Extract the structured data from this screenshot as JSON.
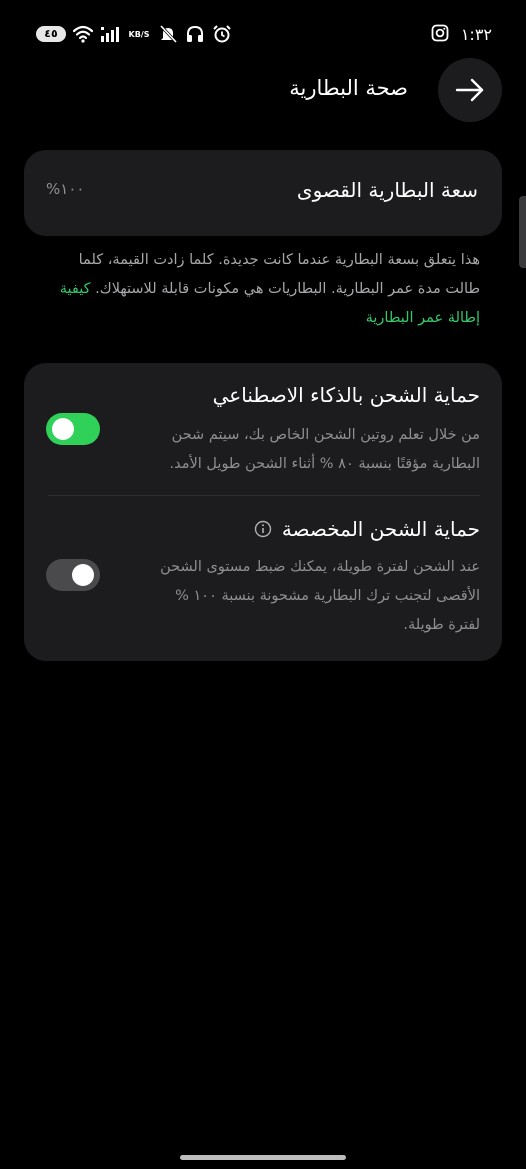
{
  "status_bar": {
    "battery_level": "٤٥",
    "net_speed": "KB/S",
    "clock": "١:٣٢",
    "icons": [
      "battery-icon",
      "wifi-icon",
      "signal-icon",
      "net-speed",
      "mute-icon",
      "headphones-icon",
      "alarm-icon",
      "instagram-icon"
    ]
  },
  "header": {
    "title": "صحة البطارية",
    "back_icon": "arrow-right-icon"
  },
  "capacity": {
    "label": "سعة البطارية القصوى",
    "value": "%١٠٠"
  },
  "info": {
    "text": "هذا يتعلق بسعة البطارية عندما كانت جديدة. كلما زادت القيمة، كلما طالت مدة عمر البطارية. البطاريات هي مكونات قابلة للاستهلاك.",
    "link": "كيفية إطالة عمر البطارية"
  },
  "ai_protection": {
    "title": "حماية الشحن بالذكاء الاصطناعي",
    "description": "من خلال تعلم روتين الشحن الخاص بك، سيتم شحن البطارية مؤقتًا بنسبة ٨٠ % أثناء الشحن طويل الأمد.",
    "enabled": true
  },
  "custom_protection": {
    "title": "حماية الشحن المخصصة",
    "description": "عند الشحن لفترة طويلة، يمكنك ضبط مستوى الشحن الأقصى لتجنب ترك البطارية مشحونة بنسبة ١٠٠ % لفترة طويلة.",
    "enabled": false,
    "info_icon": "info-icon"
  },
  "colors": {
    "background": "#000000",
    "card": "#1c1c1e",
    "accent_green": "#30d158",
    "link_green": "#36c76c",
    "secondary_text": "#8e8e93"
  }
}
